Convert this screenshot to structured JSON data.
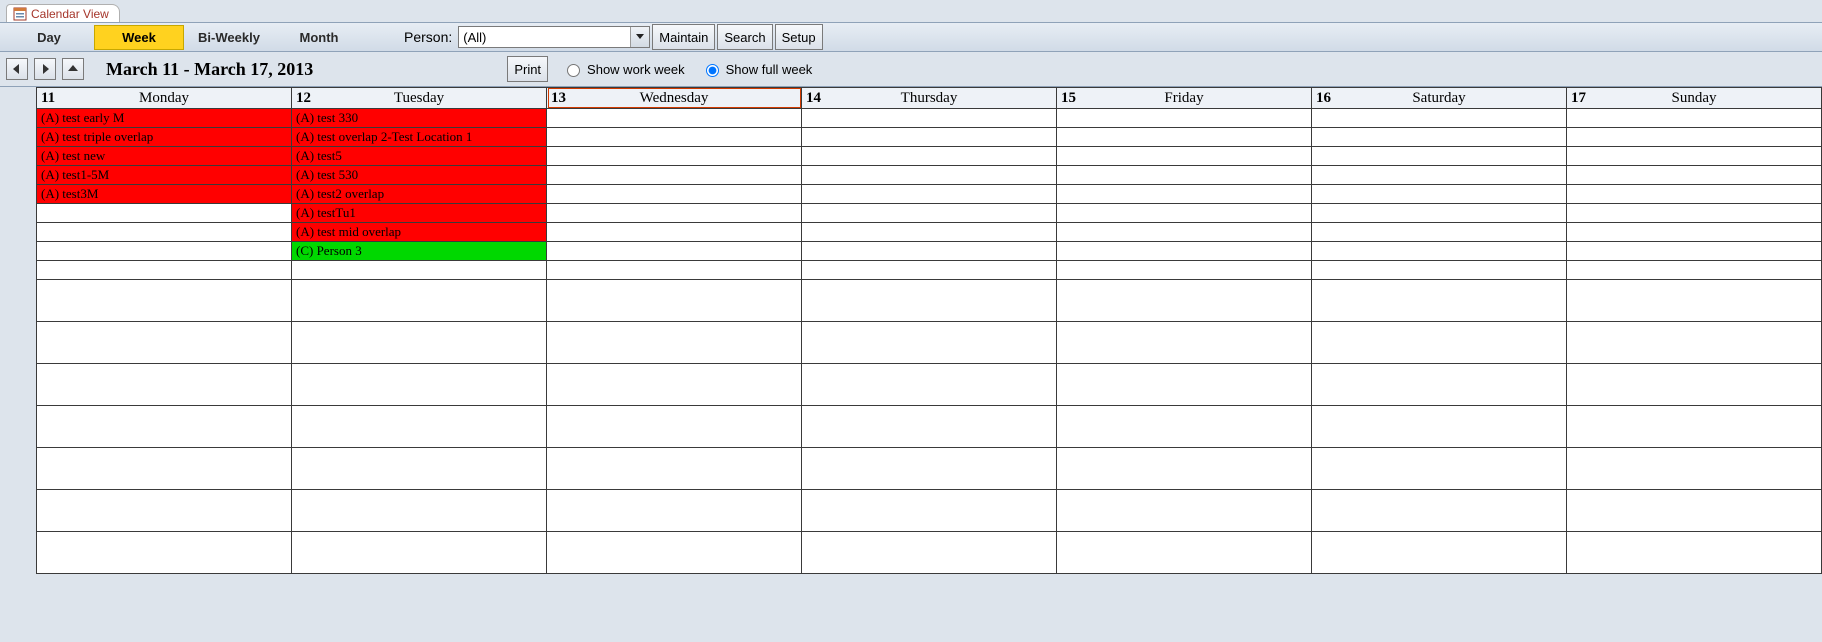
{
  "tab": {
    "title": "Calendar View"
  },
  "toolbar": {
    "views": [
      "Day",
      "Week",
      "Bi-Weekly",
      "Month"
    ],
    "active_view": "Week",
    "person_label": "Person:",
    "person_value": "(All)",
    "maintain": "Maintain",
    "search": "Search",
    "setup": "Setup"
  },
  "subbar": {
    "date_range": "March 11 - March 17, 2013",
    "print": "Print",
    "work_week": "Show work week",
    "full_week": "Show full week",
    "selected_option": "full"
  },
  "days": [
    {
      "num": "11",
      "name": "Monday"
    },
    {
      "num": "12",
      "name": "Tuesday"
    },
    {
      "num": "13",
      "name": "Wednesday"
    },
    {
      "num": "14",
      "name": "Thursday"
    },
    {
      "num": "15",
      "name": "Friday"
    },
    {
      "num": "16",
      "name": "Saturday"
    },
    {
      "num": "17",
      "name": "Sunday"
    }
  ],
  "events": {
    "0": [
      {
        "text": "(A) test early M",
        "color": "red"
      },
      {
        "text": "(A) test triple overlap",
        "color": "red"
      },
      {
        "text": "(A) test new",
        "color": "red"
      },
      {
        "text": "(A) test1-5M",
        "color": "red"
      },
      {
        "text": "(A) test3M",
        "color": "red"
      }
    ],
    "1": [
      {
        "text": "(A) test 330",
        "color": "red"
      },
      {
        "text": "(A) test overlap 2-Test Location 1",
        "color": "red"
      },
      {
        "text": "(A) test5",
        "color": "red"
      },
      {
        "text": "(A) test 530",
        "color": "red"
      },
      {
        "text": "(A) test2 overlap",
        "color": "red"
      },
      {
        "text": "(A) testTu1",
        "color": "red"
      },
      {
        "text": "(A) test mid overlap",
        "color": "red"
      },
      {
        "text": "(C) Person 3",
        "color": "green"
      }
    ],
    "2": [],
    "3": [],
    "4": [],
    "5": [],
    "6": []
  },
  "colors": {
    "red": "#ff0000",
    "green": "#00d800"
  }
}
